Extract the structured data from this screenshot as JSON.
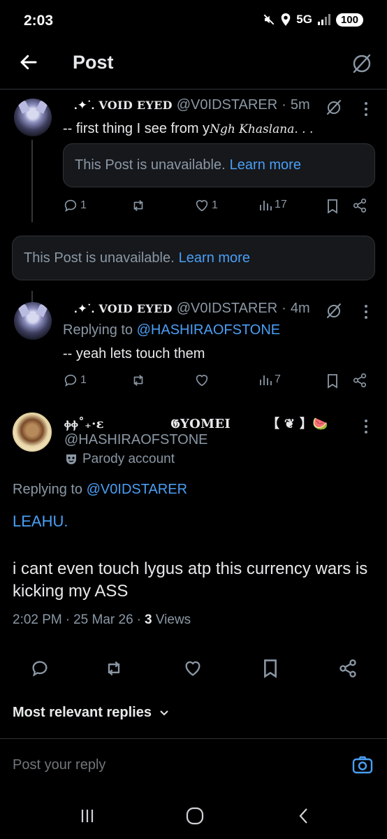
{
  "status_bar": {
    "time": "2:03",
    "network": "5G",
    "battery": "100"
  },
  "header": {
    "title": "Post"
  },
  "reply1": {
    "decoration": ".✦˙.",
    "display_name": "VOID EYED",
    "handle": "@V0IDSTARER",
    "time": "5m",
    "text_prefix": "-- first thing I see from y",
    "text_script": "Ngh Khaslana. . .",
    "quoted_unavailable": "This Post is unavailable.",
    "learn_more": "Learn more",
    "replies": "1",
    "likes": "1",
    "views": "17"
  },
  "standalone_unavailable": {
    "text": "This Post is unavailable.",
    "learn_more": "Learn more"
  },
  "reply2": {
    "decoration": ".✦˙.",
    "display_name": "VOID EYED",
    "handle": "@V0IDSTARER",
    "time": "4m",
    "replying_label": "Replying to",
    "replying_to": "@HASHIRAOFSTONE",
    "text": "-- yeah lets touch them",
    "replies": "1",
    "views": "7"
  },
  "main_post": {
    "display_name_left": "ⲫⲫ˚₊·ɛ",
    "display_name_mid": "𝕲YOMEI",
    "display_name_right": "【 ❦ 】🍉",
    "handle": "@HASHIRAOFSTONE",
    "parody_label": "Parody account",
    "replying_label": "Replying to",
    "replying_to": "@V0IDSTARER",
    "title_line": "LEAHU.",
    "body": " i cant even touch lygus atp this currency wars is kicking my ASS",
    "time": "2:02 PM",
    "date": "25 Mar 26",
    "views_count": "3",
    "views_label": "Views"
  },
  "sort": {
    "label": "Most relevant replies"
  },
  "composer": {
    "placeholder": "Post your reply"
  },
  "colors": {
    "background": "#000000",
    "accent_blue": "#4a9ff5",
    "muted": "#8b98a5",
    "text": "#e7e9ea"
  }
}
